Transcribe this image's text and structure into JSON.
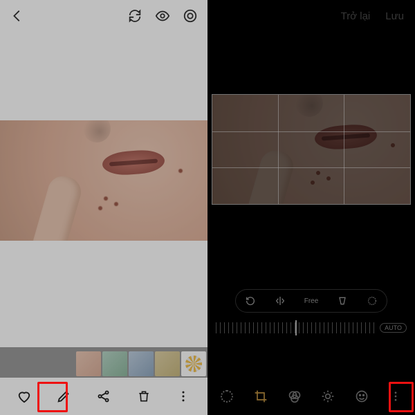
{
  "left": {
    "topIcons": {
      "back": "back",
      "sync": "sync",
      "visibility": "eye",
      "lens": "lens"
    },
    "thumbnails": [
      "photo-1",
      "photo-2",
      "photo-3",
      "photo-4",
      "collage"
    ],
    "bottom": {
      "favorite": "heart",
      "edit": "pencil",
      "share": "share",
      "delete": "trash",
      "more": "more"
    }
  },
  "right": {
    "header": {
      "back": "Trở lại",
      "save": "Lưu"
    },
    "cropToolbar": {
      "rotate": "rotate",
      "flip": "flip",
      "free": "Free",
      "perspective": "perspective",
      "circle": "lasso"
    },
    "auto": "AUTO",
    "bottom": {
      "loading": "processing",
      "crop": "crop",
      "filters": "filters",
      "brightness": "brightness",
      "sticker": "sticker",
      "more": "more"
    }
  }
}
